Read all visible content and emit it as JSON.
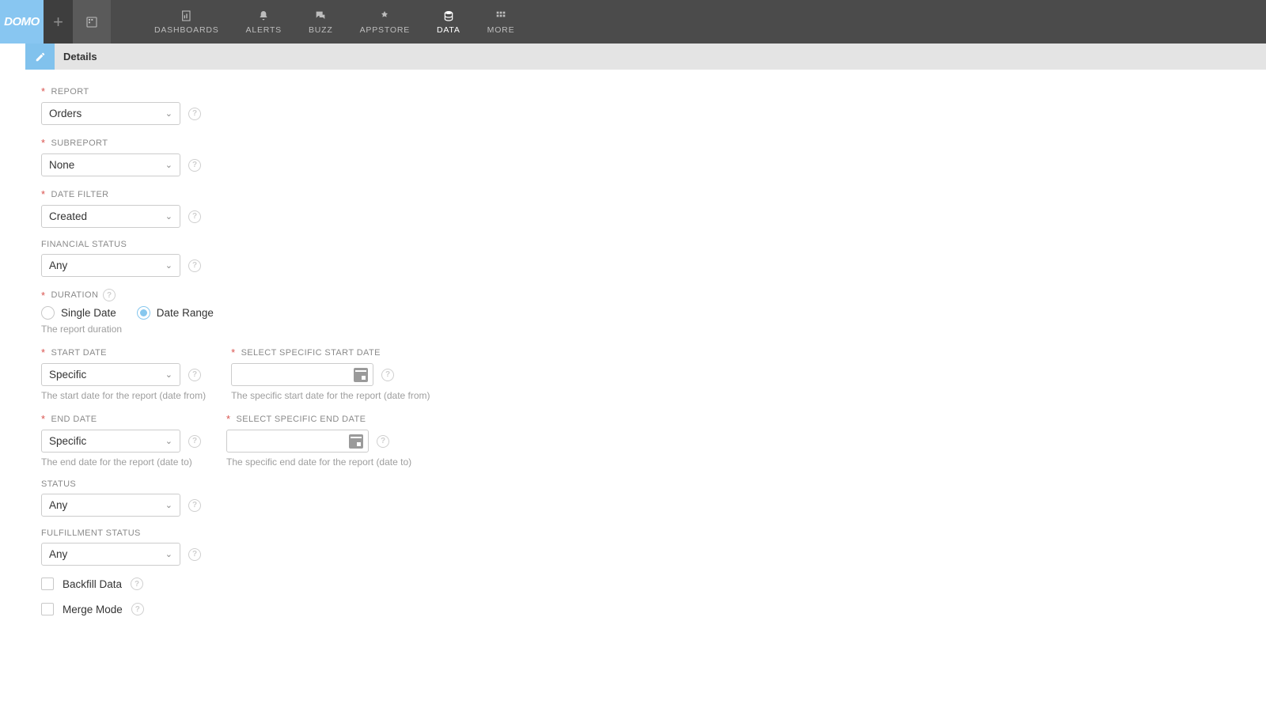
{
  "brand": "DOMO",
  "nav": {
    "items": [
      {
        "label": "DASHBOARDS"
      },
      {
        "label": "ALERTS"
      },
      {
        "label": "BUZZ"
      },
      {
        "label": "APPSTORE"
      },
      {
        "label": "DATA"
      },
      {
        "label": "MORE"
      }
    ]
  },
  "details": {
    "title": "Details"
  },
  "form": {
    "report": {
      "label": "REPORT",
      "value": "Orders",
      "required": true
    },
    "subreport": {
      "label": "SUBREPORT",
      "value": "None",
      "required": true
    },
    "date_filter": {
      "label": "DATE FILTER",
      "value": "Created",
      "required": true
    },
    "financial_status": {
      "label": "FINANCIAL STATUS",
      "value": "Any",
      "required": false
    },
    "duration": {
      "label": "DURATION",
      "required": true,
      "options": {
        "single": "Single Date",
        "range": "Date Range"
      },
      "selected": "range",
      "hint": "The report duration"
    },
    "start_date": {
      "label": "START DATE",
      "value": "Specific",
      "required": true,
      "hint": "The start date for the report (date from)"
    },
    "start_date_specific": {
      "label": "SELECT SPECIFIC START DATE",
      "required": true,
      "hint": "The specific start date for the report (date from)"
    },
    "end_date": {
      "label": "END DATE",
      "value": "Specific",
      "required": true,
      "hint": "The end date for the report (date to)"
    },
    "end_date_specific": {
      "label": "SELECT SPECIFIC END DATE",
      "required": true,
      "hint": "The specific end date for the report (date to)"
    },
    "status": {
      "label": "STATUS",
      "value": "Any",
      "required": false
    },
    "fulfillment_status": {
      "label": "FULFILLMENT STATUS",
      "value": "Any",
      "required": false
    },
    "backfill": {
      "label": "Backfill Data"
    },
    "merge": {
      "label": "Merge Mode"
    }
  }
}
